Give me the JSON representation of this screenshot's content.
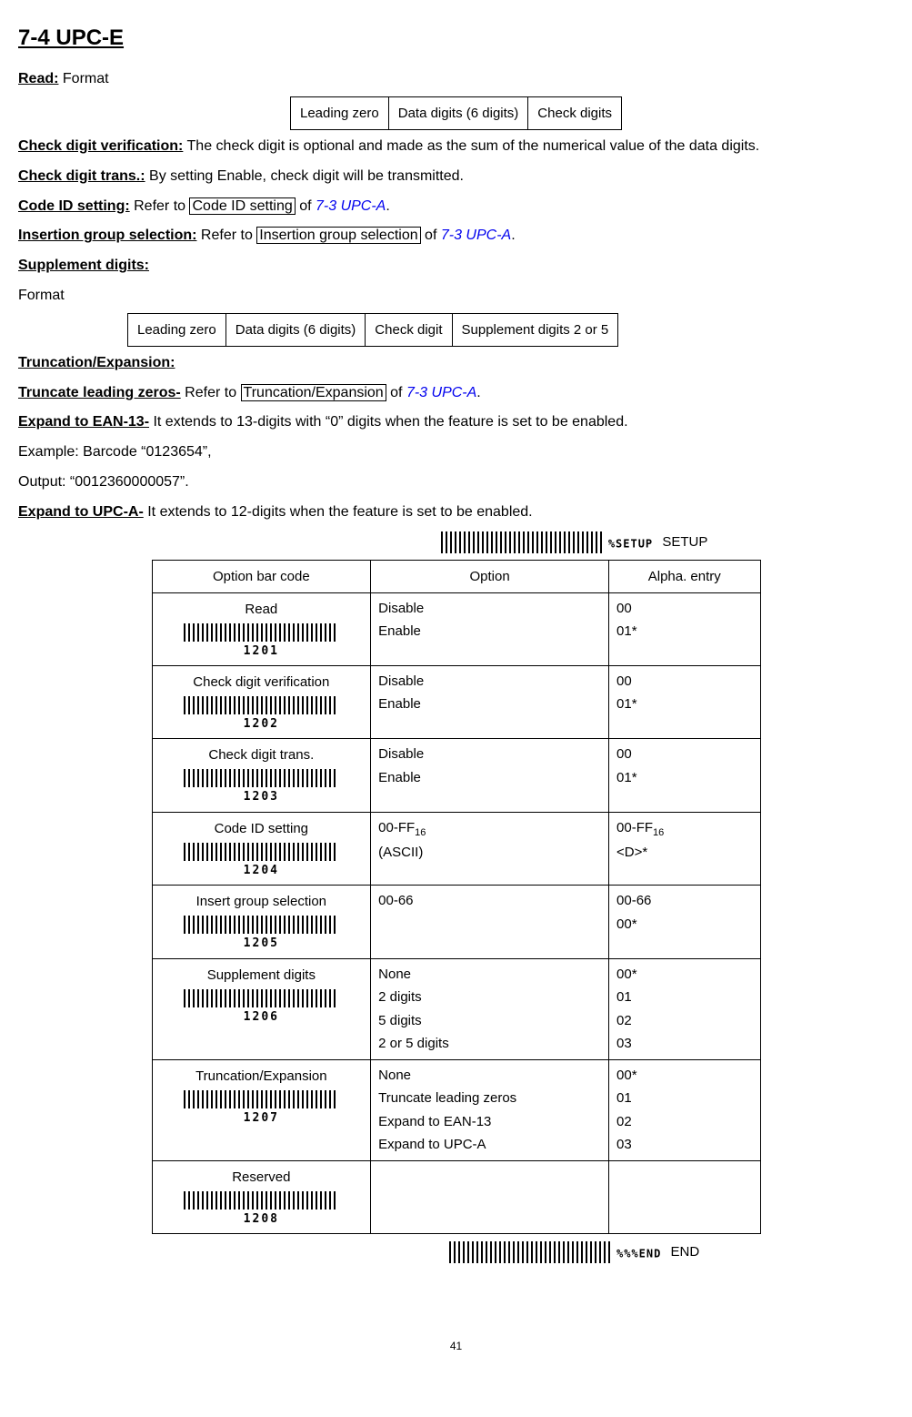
{
  "heading": "7-4 UPC-E",
  "read_label": "Read:",
  "read_value": "Format",
  "fmt1": {
    "c1": "Leading zero",
    "c2": "Data digits (6 digits)",
    "c3": "Check digits"
  },
  "check_verif_label": "Check digit verification:",
  "check_verif_text": "The check digit is optional and made as the sum of the numerical value of the data digits.",
  "check_trans_label": "Check digit trans.:",
  "check_trans_text": "By setting Enable, check digit will be transmitted.",
  "codeid_label": "Code ID setting:",
  "codeid_pre": "Refer to ",
  "codeid_box": "Code ID setting",
  "codeid_mid": " of ",
  "codeid_link": "7-3 UPC-A",
  "insgrp_label": "Insertion group selection:",
  "insgrp_pre": "Refer to ",
  "insgrp_box": "Insertion group selection",
  "insgrp_mid": " of ",
  "insgrp_link": "7-3 UPC-A",
  "supp_label": "Supplement digits:",
  "supp_format": "Format",
  "fmt2": {
    "c1": "Leading zero",
    "c2": "Data digits (6 digits)",
    "c3": "Check digit",
    "c4": "Supplement digits 2 or 5"
  },
  "trexp_hdr": "Truncation/Expansion:",
  "trunc_label": "Truncate leading zeros-",
  "trunc_pre": "Refer to ",
  "trunc_box": "Truncation/Expansion",
  "trunc_mid": " of ",
  "trunc_link": "7-3 UPC-A",
  "exp13_label": "Expand to EAN-13-",
  "exp13_text": "It extends to 13-digits with “0” digits when the feature is set to be enabled.",
  "example_label": "Example: Barcode “0123654”,",
  "output_label": "Output: “0012360000057”.",
  "expupca_label": "Expand to UPC-A-",
  "expupca_text": "It extends to 12-digits when the feature is set to be enabled.",
  "setup_code": "%SETUP",
  "setup_label": "SETUP",
  "end_code": "%%%END",
  "end_label": "END",
  "table": {
    "h1": "Option bar code",
    "h2": "Option",
    "h3": "Alpha. entry",
    "rows": [
      {
        "name": "Read",
        "code": "1201",
        "opts": [
          "Disable",
          "Enable"
        ],
        "vals": [
          "00",
          "01*"
        ]
      },
      {
        "name": "Check digit verification",
        "code": "1202",
        "opts": [
          "Disable",
          "Enable"
        ],
        "vals": [
          "00",
          "01*"
        ]
      },
      {
        "name": "Check digit trans.",
        "code": "1203",
        "opts": [
          "Disable",
          "Enable"
        ],
        "vals": [
          "00",
          "01*"
        ]
      },
      {
        "name": "Code ID setting",
        "code": "1204",
        "opts": [
          "00-FF",
          "(ASCII)"
        ],
        "vals": [
          "00-FF",
          "<D>*"
        ],
        "sub16a": true,
        "sub16b": true
      },
      {
        "name": "Insert group selection",
        "code": "1205",
        "opts": [
          "00-66"
        ],
        "vals": [
          "00-66",
          "00*"
        ]
      },
      {
        "name": "Supplement digits",
        "code": "1206",
        "opts": [
          "None",
          "2 digits",
          "5 digits",
          "2 or 5 digits"
        ],
        "vals": [
          "00*",
          "01",
          "02",
          "03"
        ]
      },
      {
        "name": "Truncation/Expansion",
        "code": "1207",
        "opts": [
          "None",
          "Truncate leading zeros",
          "Expand to EAN-13",
          "Expand to UPC-A"
        ],
        "vals": [
          "00*",
          "01",
          "02",
          "03"
        ]
      },
      {
        "name": "Reserved",
        "code": "1208",
        "opts": [
          ""
        ],
        "vals": [
          ""
        ]
      }
    ]
  },
  "page": "41",
  "period": "."
}
